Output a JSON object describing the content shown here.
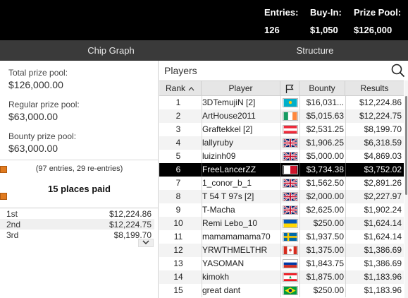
{
  "header": {
    "entries_label": "Entries:",
    "entries_value": "126",
    "buyin_label": "Buy-In:",
    "buyin_value": "$1,050",
    "prize_label": "Prize Pool:",
    "prize_value": "$126,000"
  },
  "tabs": [
    {
      "label": "Chip Graph"
    },
    {
      "label": "Structure"
    }
  ],
  "prize_info": {
    "total_label": "Total prize pool:",
    "total_value": "$126,000.00",
    "regular_label": "Regular prize pool:",
    "regular_value": "$63,000.00",
    "bounty_label": "Bounty prize pool:",
    "bounty_value": "$63,000.00",
    "entries_note": "(97 entries, 29 re-entries)",
    "places_paid": "15 places paid"
  },
  "payouts": [
    {
      "place": "1st",
      "amount": "$12,224.86"
    },
    {
      "place": "2nd",
      "amount": "$12,224.75"
    },
    {
      "place": "3rd",
      "amount": "$8,199.70"
    }
  ],
  "players_panel": {
    "title": "Players",
    "columns": {
      "rank": "Rank",
      "player": "Player",
      "bounty": "Bounty",
      "results": "Results"
    },
    "rows": [
      {
        "rank": "1",
        "player": "3DTemujiN [2]",
        "flag": "kazakhstan",
        "bounty": "$16,031...",
        "results": "$12,224.86"
      },
      {
        "rank": "2",
        "player": "ArtHouse2011",
        "flag": "ireland",
        "bounty": "$5,015.63",
        "results": "$12,224.75"
      },
      {
        "rank": "3",
        "player": "Graftekkel [2]",
        "flag": "austria",
        "bounty": "$2,531.25",
        "results": "$8,199.70"
      },
      {
        "rank": "4",
        "player": "lallyruby",
        "flag": "united-kingdom",
        "bounty": "$1,906.25",
        "results": "$6,318.59"
      },
      {
        "rank": "5",
        "player": "luizinh09",
        "flag": "united-kingdom",
        "bounty": "$5,000.00",
        "results": "$4,869.03"
      },
      {
        "rank": "6",
        "player": "FreeLancerZZ",
        "flag": "malta",
        "bounty": "$3,734.38",
        "results": "$3,752.02"
      },
      {
        "rank": "7",
        "player": "1_conor_b_1",
        "flag": "united-kingdom",
        "bounty": "$1,562.50",
        "results": "$2,891.26"
      },
      {
        "rank": "8",
        "player": "T 54 T 97s [2]",
        "flag": "united-kingdom",
        "bounty": "$2,000.00",
        "results": "$2,227.97"
      },
      {
        "rank": "9",
        "player": "T-Macha",
        "flag": "united-kingdom",
        "bounty": "$2,625.00",
        "results": "$1,902.24"
      },
      {
        "rank": "10",
        "player": "Remi Lebo_10",
        "flag": "ukraine",
        "bounty": "$250.00",
        "results": "$1,624.14"
      },
      {
        "rank": "11",
        "player": "mamamamama70",
        "flag": "sweden",
        "bounty": "$1,937.50",
        "results": "$1,624.14"
      },
      {
        "rank": "12",
        "player": "YRWTHMELTHR",
        "flag": "canada",
        "bounty": "$1,375.00",
        "results": "$1,386.69"
      },
      {
        "rank": "13",
        "player": "YASOMAN",
        "flag": "russia",
        "bounty": "$1,843.75",
        "results": "$1,386.69"
      },
      {
        "rank": "14",
        "player": "kimokh",
        "flag": "lebanon",
        "bounty": "$1,875.00",
        "results": "$1,183.96"
      },
      {
        "rank": "15",
        "player": "great dant",
        "flag": "brazil",
        "bounty": "$250.00",
        "results": "$1,183.96"
      }
    ]
  },
  "icons": {
    "search": "search-icon",
    "flag_column": "flag-icon",
    "sort": "chevron-up-icon",
    "expand": "chevron-down-icon",
    "bookmark": "bookmark-icon"
  },
  "colors": {
    "topbar_bg": "#000000",
    "tabbar_bg": "#3a3a3a",
    "highlight_row": "#000000",
    "bookmark": "#e07a1f"
  }
}
